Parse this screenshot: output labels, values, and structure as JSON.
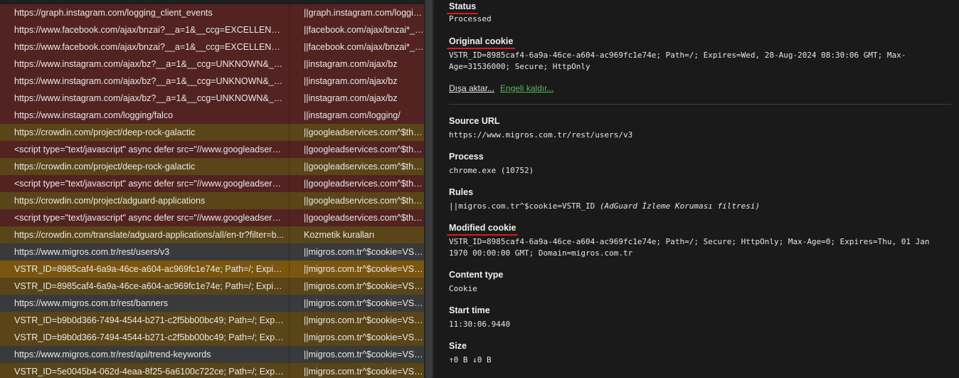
{
  "requests": [
    {
      "url": "https://graph.instagram.com/logging_client_events",
      "rule": "||graph.instagram.com/logging...",
      "color": "red"
    },
    {
      "url": "https://www.facebook.com/ajax/bnzai?__a=1&__ccg=EXCELLENT&__c...",
      "rule": "||facebook.com/ajax/bnzai*__c...",
      "color": "red"
    },
    {
      "url": "https://www.facebook.com/ajax/bnzai?__a=1&__ccg=EXCELLENT&__c...",
      "rule": "||facebook.com/ajax/bnzai*__c...",
      "color": "red"
    },
    {
      "url": "https://www.instagram.com/ajax/bz?__a=1&__ccg=UNKNOWN&__co...",
      "rule": "||instagram.com/ajax/bz",
      "color": "red"
    },
    {
      "url": "https://www.instagram.com/ajax/bz?__a=1&__ccg=UNKNOWN&__co...",
      "rule": "||instagram.com/ajax/bz",
      "color": "red"
    },
    {
      "url": "https://www.instagram.com/ajax/bz?__a=1&__ccg=UNKNOWN&__co...",
      "rule": "||instagram.com/ajax/bz",
      "color": "red"
    },
    {
      "url": "https://www.instagram.com/logging/falco",
      "rule": "||instagram.com/logging/",
      "color": "red"
    },
    {
      "url": "https://crowdin.com/project/deep-rock-galactic",
      "rule": "||googleadservices.com^$third...",
      "color": "gold"
    },
    {
      "url": "<script type=\"text/javascript\" async defer src=\"//www.googleadservi...",
      "rule": "||googleadservices.com^$third...",
      "color": "red"
    },
    {
      "url": "https://crowdin.com/project/deep-rock-galactic",
      "rule": "||googleadservices.com^$third...",
      "color": "gold"
    },
    {
      "url": "<script type=\"text/javascript\" async defer src=\"//www.googleadservi...",
      "rule": "||googleadservices.com^$third...",
      "color": "red"
    },
    {
      "url": "https://crowdin.com/project/adguard-applications",
      "rule": "||googleadservices.com^$third...",
      "color": "gold"
    },
    {
      "url": "<script type=\"text/javascript\" async defer src=\"//www.googleadservi...",
      "rule": "||googleadservices.com^$third...",
      "color": "red"
    },
    {
      "url": "https://crowdin.com/translate/adguard-applications/all/en-tr?filter=b...",
      "rule": "Kozmetik kuralları",
      "color": "gold"
    },
    {
      "url": "https://www.migros.com.tr/rest/users/v3",
      "rule": "||migros.com.tr^$cookie=VST...",
      "color": "gray"
    },
    {
      "url": "VSTR_ID=8985caf4-6a9a-46ce-a604-ac969fc1e74e; Path=/; Expires=...",
      "rule": "||migros.com.tr^$cookie=VST...",
      "color": "orange"
    },
    {
      "url": "VSTR_ID=8985caf4-6a9a-46ce-a604-ac969fc1e74e; Path=/; Expires=...",
      "rule": "||migros.com.tr^$cookie=VST...",
      "color": "gold"
    },
    {
      "url": "https://www.migros.com.tr/rest/banners",
      "rule": "||migros.com.tr^$cookie=VST...",
      "color": "gray"
    },
    {
      "url": "VSTR_ID=b9b0d366-7494-4544-b271-c2f5bb00bc49; Path=/; Expires...",
      "rule": "||migros.com.tr^$cookie=VST...",
      "color": "gold"
    },
    {
      "url": "VSTR_ID=b9b0d366-7494-4544-b271-c2f5bb00bc49; Path=/; Expires...",
      "rule": "||migros.com.tr^$cookie=VST...",
      "color": "gold"
    },
    {
      "url": "https://www.migros.com.tr/rest/api/trend-keywords",
      "rule": "||migros.com.tr^$cookie=VST...",
      "color": "gray"
    },
    {
      "url": "VSTR_ID=5e0045b4-062d-4eaa-8f25-6a6100c722ce; Path=/; Expires...",
      "rule": "||migros.com.tr^$cookie=VST...",
      "color": "gold"
    }
  ],
  "details": {
    "status_label": "Status",
    "status_value": "Processed",
    "original_cookie_label": "Original cookie",
    "original_cookie_value": "VSTR_ID=8985caf4-6a9a-46ce-a604-ac969fc1e74e; Path=/; Expires=Wed, 28-Aug-2024 08:30:06 GMT; Max-Age=31536000; Secure; HttpOnly",
    "export_link": "Dışa aktar...",
    "unblock_link": "Engeli kaldır...",
    "source_url_label": "Source URL",
    "source_url_value": "https://www.migros.com.tr/rest/users/v3",
    "process_label": "Process",
    "process_value": "chrome.exe (10752)",
    "rules_label": "Rules",
    "rules_value": "||migros.com.tr^$cookie=VSTR_ID",
    "rules_note": "(AdGuard İzleme Koruması filtresi)",
    "modified_cookie_label": "Modified cookie",
    "modified_cookie_value": "VSTR_ID=8985caf4-6a9a-46ce-a604-ac969fc1e74e; Path=/; Secure; HttpOnly; Max-Age=0; Expires=Thu, 01 Jan 1970 00:00:00 GMT; Domain=migros.com.tr",
    "content_type_label": "Content type",
    "content_type_value": "Cookie",
    "start_time_label": "Start time",
    "start_time_value": "11:30:06.9440",
    "size_label": "Size",
    "size_value": "↑0 B ↓0 B"
  }
}
